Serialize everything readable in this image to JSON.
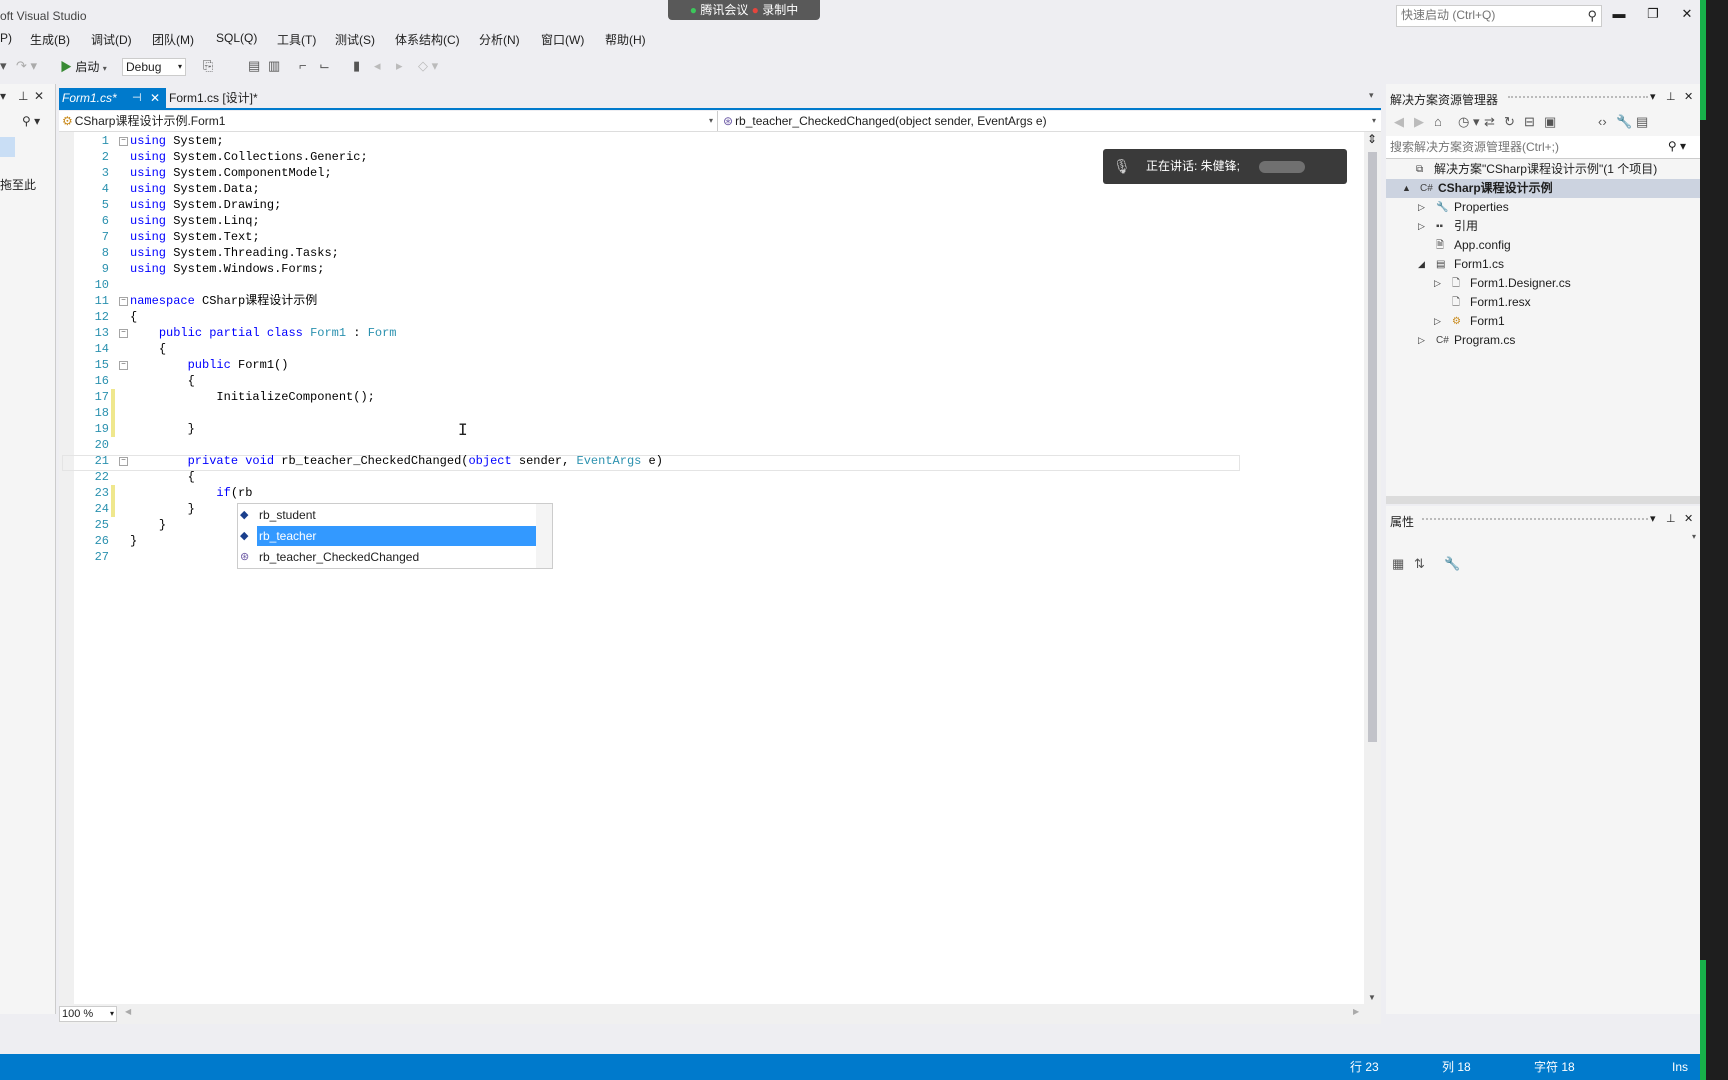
{
  "window": {
    "title": "oft Visual Studio"
  },
  "meeting_banner": {
    "app": "腾讯会议",
    "recording": "录制中"
  },
  "quick_launch": {
    "placeholder": "快速启动 (Ctrl+Q)"
  },
  "menu": [
    "P)",
    "生成(B)",
    "调试(D)",
    "团队(M)",
    "SQL(Q)",
    "工具(T)",
    "测试(S)",
    "体系结构(C)",
    "分析(N)",
    "窗口(W)",
    "帮助(H)"
  ],
  "toolbar": {
    "start_label": "启动",
    "configuration": "Debug"
  },
  "left_panel": {
    "drag_hint": "拖至此"
  },
  "tabs": [
    {
      "label": "Form1.cs*",
      "active": true
    },
    {
      "label": "Form1.cs [设计]*",
      "active": false
    }
  ],
  "navbar": {
    "type": "CSharp课程设计示例.Form1",
    "member": "rb_teacher_CheckedChanged(object sender, EventArgs e)"
  },
  "code_lines": [
    "using System;",
    "using System.Collections.Generic;",
    "using System.ComponentModel;",
    "using System.Data;",
    "using System.Drawing;",
    "using System.Linq;",
    "using System.Text;",
    "using System.Threading.Tasks;",
    "using System.Windows.Forms;",
    "",
    "namespace CSharp课程设计示例",
    "{",
    "    public partial class Form1 : Form",
    "    {",
    "        public Form1()",
    "        {",
    "            InitializeComponent();",
    "",
    "        }",
    "",
    "        private void rb_teacher_CheckedChanged(object sender, EventArgs e)",
    "        {",
    "            if(rb",
    "        }",
    "    }",
    "}",
    ""
  ],
  "completion": {
    "items": [
      "rb_student",
      "rb_teacher",
      "rb_teacher_CheckedChanged"
    ],
    "selected": "rb_teacher"
  },
  "speaking_toast": {
    "text": "正在讲话: 朱健锋;"
  },
  "zoom": "100 %",
  "solution_explorer": {
    "title": "解决方案资源管理器",
    "search_placeholder": "搜索解决方案资源管理器(Ctrl+;)",
    "tree": [
      {
        "label": "解决方案\"CSharp课程设计示例\"(1 个项目)",
        "icon": "solution-icon",
        "arrow": "",
        "selected": false
      },
      {
        "label": "CSharp课程设计示例",
        "icon": "csharp-project-icon",
        "arrow": "▲",
        "selected": true
      },
      {
        "label": "Properties",
        "icon": "wrench-icon",
        "arrow": "▷",
        "selected": false
      },
      {
        "label": "引用",
        "icon": "references-icon",
        "arrow": "▷",
        "selected": false
      },
      {
        "label": "App.config",
        "icon": "config-file-icon",
        "arrow": "",
        "selected": false
      },
      {
        "label": "Form1.cs",
        "icon": "form-icon",
        "arrow": "◢",
        "selected": false
      },
      {
        "label": "Form1.Designer.cs",
        "icon": "cs-file-icon",
        "arrow": "▷",
        "selected": false
      },
      {
        "label": "Form1.resx",
        "icon": "resx-file-icon",
        "arrow": "",
        "selected": false
      },
      {
        "label": "Form1",
        "icon": "class-icon",
        "arrow": "▷",
        "selected": false
      },
      {
        "label": "Program.cs",
        "icon": "csharp-file-icon",
        "arrow": "▷",
        "selected": false
      }
    ]
  },
  "properties": {
    "title": "属性"
  },
  "statusbar": {
    "line": "行 23",
    "col": "列 18",
    "char": "字符 18",
    "mode": "Ins"
  },
  "colors": {
    "accent": "#007acc",
    "selection": "#3399ff",
    "keyword": "#0000ff",
    "type": "#2b91af"
  }
}
